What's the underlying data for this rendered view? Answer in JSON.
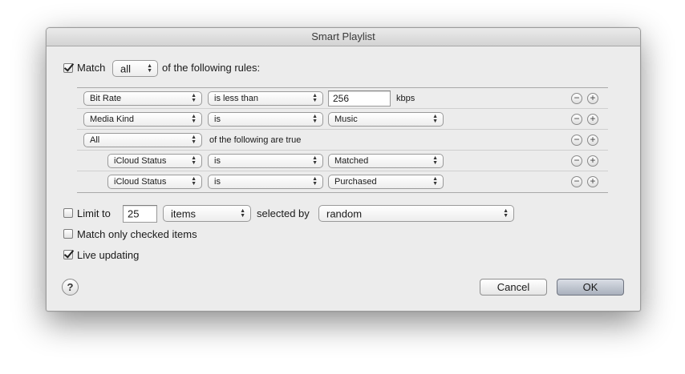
{
  "window": {
    "title": "Smart Playlist"
  },
  "match": {
    "checked": true,
    "label": "Match",
    "mode": "all",
    "suffix": "of the following rules:"
  },
  "rules": [
    {
      "field": "Bit Rate",
      "operator": "is less than",
      "value_text": "256",
      "unit": "kbps"
    },
    {
      "field": "Media Kind",
      "operator": "is",
      "value_popup": "Music"
    },
    {
      "field": "All",
      "suffix": "of the following are true"
    },
    {
      "field": "iCloud Status",
      "operator": "is",
      "value_popup": "Matched"
    },
    {
      "field": "iCloud Status",
      "operator": "is",
      "value_popup": "Purchased"
    }
  ],
  "rule_buttons": {
    "minus": "−",
    "plus": "+"
  },
  "limit": {
    "checked": false,
    "label": "Limit to",
    "count": "25",
    "unit": "items",
    "selected_by_label": "selected by",
    "selected_by": "random"
  },
  "match_checked": {
    "checked": false,
    "label": "Match only checked items"
  },
  "live_updating": {
    "checked": true,
    "label": "Live updating"
  },
  "buttons": {
    "help": "?",
    "cancel": "Cancel",
    "ok": "OK"
  },
  "icons": {
    "updown": "up-down-arrows-icon",
    "check": "checkmark-icon"
  }
}
